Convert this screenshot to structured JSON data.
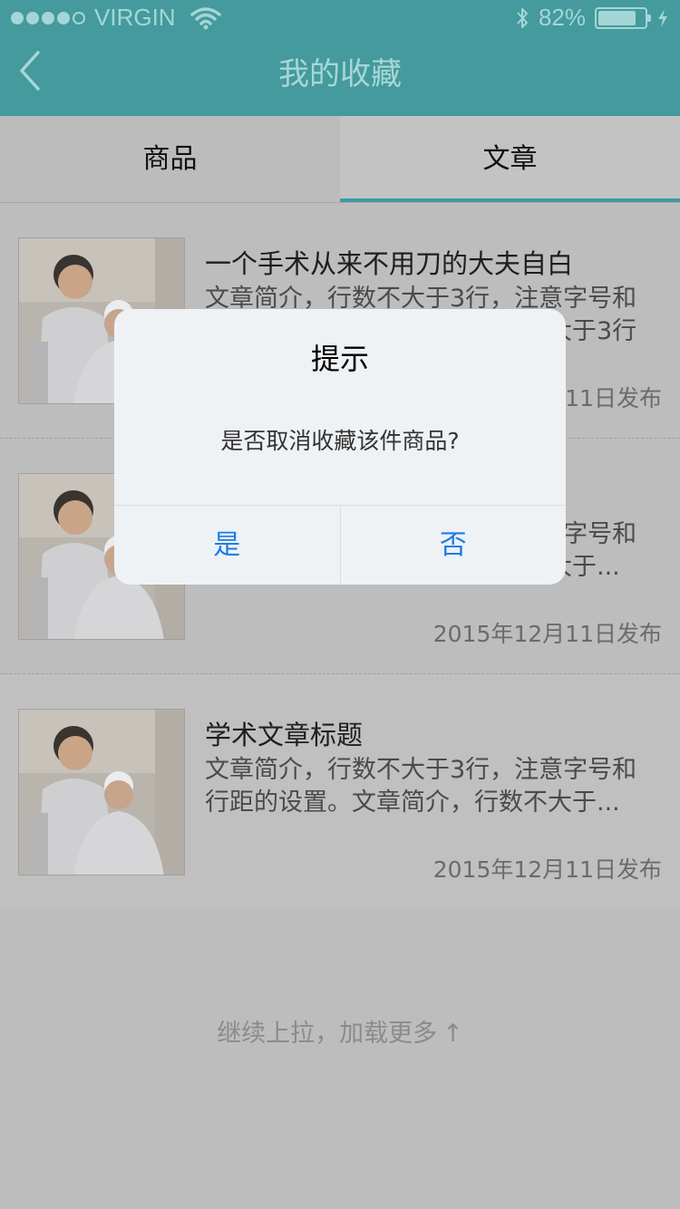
{
  "status_bar": {
    "carrier": "VIRGIN",
    "signal_dots_filled": 4,
    "signal_dots_total": 5,
    "battery_percent_label": "82%",
    "battery_level": 0.82,
    "icons": [
      "wifi-icon",
      "bluetooth-icon",
      "battery-icon",
      "charging-bolt-icon"
    ]
  },
  "nav": {
    "title": "我的收藏",
    "back_icon": "chevron-left-icon"
  },
  "tabs": [
    {
      "label": "商品",
      "active": false
    },
    {
      "label": "文章",
      "active": true
    }
  ],
  "articles": [
    {
      "title": "一个手术从来不用刀的大夫自白",
      "desc": "文章简介，行数不大于3行，注意字号和行距的设置。文章简介，行数不大于3行",
      "date": "2015年12月11日发布",
      "thumb_icon": "doctor-nurse-photo"
    },
    {
      "title": "",
      "desc": "文章简介，行数不大于3行，注意字号和行距的设置。文章简介，行数不大于...",
      "date": "2015年12月11日发布",
      "thumb_icon": "doctor-nurse-photo"
    },
    {
      "title": "学术文章标题",
      "desc": "文章简介，行数不大于3行，注意字号和行距的设置。文章简介，行数不大于...",
      "date": "2015年12月11日发布",
      "thumb_icon": "doctor-nurse-photo"
    }
  ],
  "footer": {
    "load_more": "继续上拉，加载更多",
    "arrow": "↑"
  },
  "dialog": {
    "title": "提示",
    "message": "是否取消收藏该件商品?",
    "yes": "是",
    "no": "否"
  },
  "colors": {
    "header": "#449a9c",
    "tab_indicator": "#3f9aa4",
    "dialog_button": "#1b7de8"
  }
}
